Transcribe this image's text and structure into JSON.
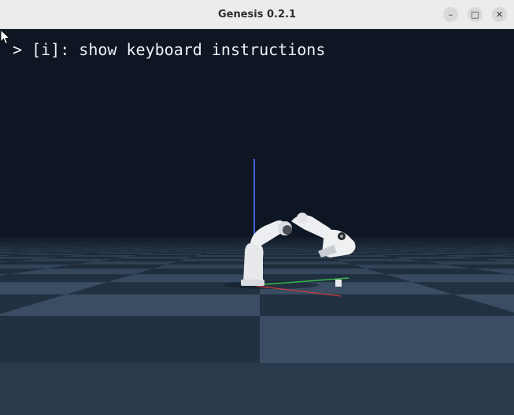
{
  "window": {
    "title": "Genesis 0.2.1",
    "controls": {
      "minimize": "–",
      "maximize": "□",
      "close": "✕"
    }
  },
  "viewport": {
    "overlay_text": "> [i]: show keyboard instructions",
    "colors": {
      "sky": "#0d1622",
      "floor_dark": "#223142",
      "floor_light": "#3a4d63",
      "robot": "#e9ebee",
      "axis_z": "#3d63d6",
      "axis_x": "#c83c3c",
      "axis_y": "#35b84a"
    }
  }
}
